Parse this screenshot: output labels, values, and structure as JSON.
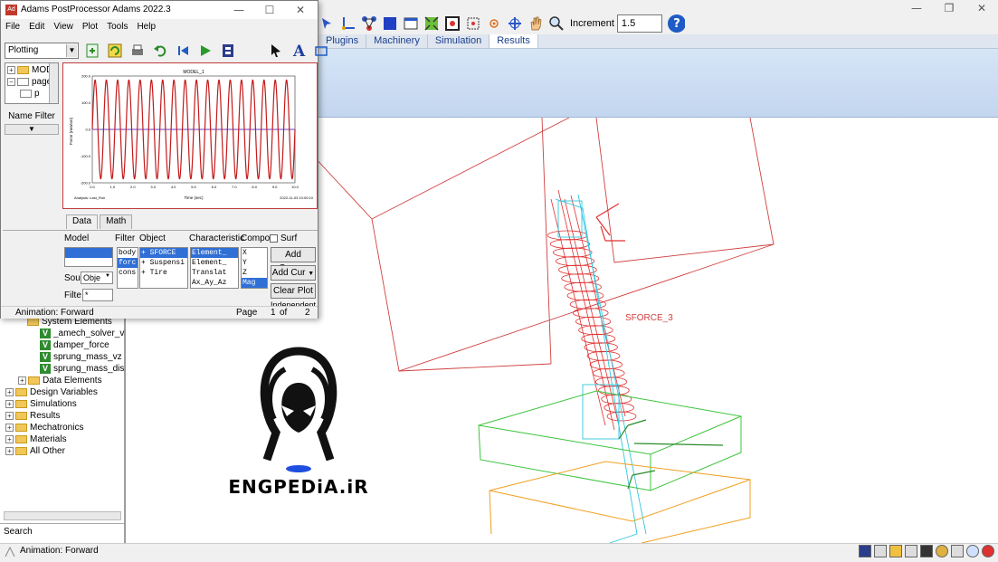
{
  "main_window": {
    "increment_label": "Increment",
    "increment_value": "1.5",
    "ribbon_tabs": [
      {
        "label": "Plugins",
        "active": false
      },
      {
        "label": "Machinery",
        "active": false
      },
      {
        "label": "Simulation",
        "active": false
      },
      {
        "label": "Results",
        "active": true
      }
    ],
    "tree": {
      "system_elements": "System Elements",
      "items": [
        "_amech_solver_va",
        "damper_force",
        "sprung_mass_vz",
        "sprung_mass_dis"
      ],
      "data_elements": "Data Elements",
      "top_items": [
        "Design Variables",
        "Simulations",
        "Results",
        "Mechatronics",
        "Materials",
        "All Other"
      ]
    },
    "search_label": "Search",
    "status_text": "Animation: Forward",
    "view_label": "SFORCE_3",
    "logo_text": "ENGPEDiA.iR"
  },
  "postprocessor": {
    "title": "Adams  PostProcessor Adams 2022.3",
    "menu": [
      "File",
      "Edit",
      "View",
      "Plot",
      "Tools",
      "Help"
    ],
    "mode": "Plotting",
    "tree_items": [
      "MOD",
      "page",
      "p"
    ],
    "name_filter": "Name Filter",
    "tabs": [
      {
        "label": "Data",
        "active": true
      },
      {
        "label": "Math",
        "active": false
      }
    ],
    "labels": {
      "model": "Model",
      "filter": "Filter",
      "object": "Object",
      "characteristic": "Characteristic",
      "component": "Compo",
      "surf": "Surf",
      "source": "Sou",
      "filter_short": "Filte",
      "independent": "Independent"
    },
    "source_value": "Obje",
    "filter_value": "*",
    "filter_list": [
      "body",
      "forc",
      "cons"
    ],
    "object_list": [
      "+ SFORCE",
      "+ Suspensi",
      "+ Tire"
    ],
    "characteristic_list": [
      "Element_",
      "Element_",
      "Translat",
      "Ax_Ay_Az"
    ],
    "component_list": [
      "X",
      "Y",
      "Z",
      "Mag"
    ],
    "buttons": {
      "add_curves": "Add Curves",
      "add_cur": "Add Cur",
      "clear_plot": "Clear Plot"
    },
    "status_left": "Animation: Forward",
    "page_label": "Page",
    "page_current": "1",
    "page_of": "of",
    "page_total": "2"
  },
  "chart_data": {
    "type": "line",
    "title": "MODEL_1",
    "xlabel": "Time (sec)",
    "ylabel": "Force (newton)",
    "xlim": [
      0,
      10
    ],
    "ylim": [
      -200,
      200
    ],
    "x_ticks": [
      "0.0",
      "1.0",
      "2.0",
      "3.0",
      "4.0",
      "5.0",
      "6.0",
      "7.0",
      "8.0",
      "9.0",
      "10.0"
    ],
    "y_ticks": [
      "200.0",
      "100.0",
      "0.0",
      "-100.0",
      "-200.0"
    ],
    "series": [
      {
        "name": "",
        "color": "#c41a1a",
        "frequency_hz": 1.8,
        "amplitude": 185,
        "offset": 0
      }
    ],
    "footer_left": "Analysis: Last_Run",
    "footer_right": "2022-11-03 10:00:10"
  }
}
